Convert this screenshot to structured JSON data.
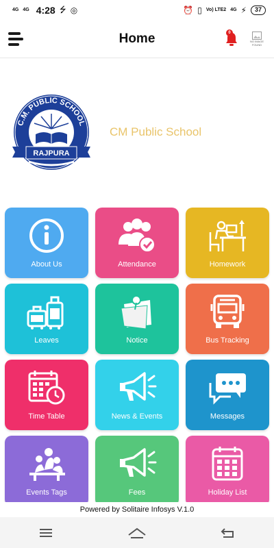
{
  "status_bar": {
    "signal_1": "4G",
    "signal_2": "4G",
    "time": "4:28",
    "network": "Vo) LTE2",
    "network_2": "4G",
    "battery": "37"
  },
  "app_bar": {
    "title": "Home",
    "notification_count": "0",
    "avatar_placeholder": "NO IMAGE FOUND"
  },
  "banner": {
    "logo_top_text": "C.M. PUBLIC SCHOOL",
    "logo_bottom_text": "RAJPURA",
    "school_name": "CM Public School"
  },
  "tiles": [
    {
      "label": "About Us",
      "color": "#4faaf0",
      "icon": "info-icon"
    },
    {
      "label": "Attendance",
      "color": "#ea4d87",
      "icon": "attendance-icon"
    },
    {
      "label": "Homework",
      "color": "#e6b723",
      "icon": "homework-icon"
    },
    {
      "label": "Leaves",
      "color": "#1ec1d8",
      "icon": "luggage-icon"
    },
    {
      "label": "Notice",
      "color": "#1ec39c",
      "icon": "notice-icon"
    },
    {
      "label": "Bus Tracking",
      "color": "#ef6f4a",
      "icon": "bus-icon"
    },
    {
      "label": "Time Table",
      "color": "#ef2f6a",
      "icon": "calendar-clock-icon"
    },
    {
      "label": "News & Events",
      "color": "#33d1ea",
      "icon": "megaphone-icon"
    },
    {
      "label": "Messages",
      "color": "#1e94cc",
      "icon": "chat-icon"
    },
    {
      "label": "Events Tags",
      "color": "#8c6bd8",
      "icon": "event-icon"
    },
    {
      "label": "Fees",
      "color": "#56c77b",
      "icon": "megaphone-icon"
    },
    {
      "label": "Holiday List",
      "color": "#ea5aa6",
      "icon": "calendar-icon"
    }
  ],
  "footer": {
    "powered_by": "Powered by Solitaire Infosys V.1.0"
  }
}
